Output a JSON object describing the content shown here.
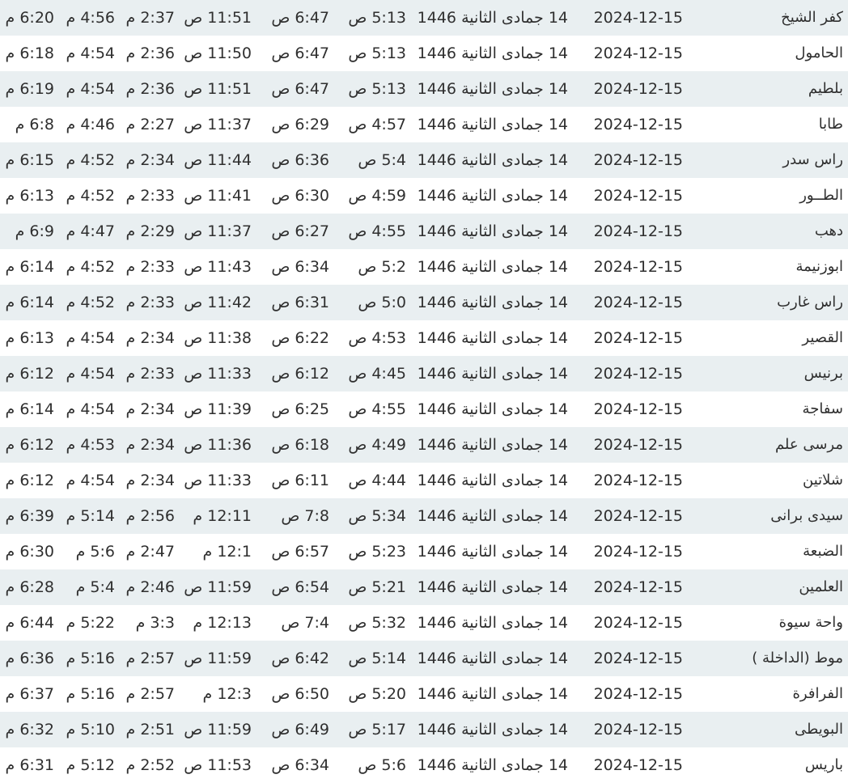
{
  "rows": [
    {
      "city": "كفر الشيخ",
      "gregorian": "2024-12-15",
      "hijri": "14 جمادى الثانية 1446",
      "fajr": "5:13 ص",
      "shuruq": "6:47 ص",
      "dhuhr": "11:51 ص",
      "asr": "2:37 م",
      "maghrib": "4:56 م",
      "isha": "6:20 م"
    },
    {
      "city": "الحامول",
      "gregorian": "2024-12-15",
      "hijri": "14 جمادى الثانية 1446",
      "fajr": "5:13 ص",
      "shuruq": "6:47 ص",
      "dhuhr": "11:50 ص",
      "asr": "2:36 م",
      "maghrib": "4:54 م",
      "isha": "6:18 م"
    },
    {
      "city": "بلطيم",
      "gregorian": "2024-12-15",
      "hijri": "14 جمادى الثانية 1446",
      "fajr": "5:13 ص",
      "shuruq": "6:47 ص",
      "dhuhr": "11:51 ص",
      "asr": "2:36 م",
      "maghrib": "4:54 م",
      "isha": "6:19 م"
    },
    {
      "city": "طابا",
      "gregorian": "2024-12-15",
      "hijri": "14 جمادى الثانية 1446",
      "fajr": "4:57 ص",
      "shuruq": "6:29 ص",
      "dhuhr": "11:37 ص",
      "asr": "2:27 م",
      "maghrib": "4:46 م",
      "isha": "6:8 م"
    },
    {
      "city": "راس سدر",
      "gregorian": "2024-12-15",
      "hijri": "14 جمادى الثانية 1446",
      "fajr": "5:4 ص",
      "shuruq": "6:36 ص",
      "dhuhr": "11:44 ص",
      "asr": "2:34 م",
      "maghrib": "4:52 م",
      "isha": "6:15 م"
    },
    {
      "city": "الطــور",
      "gregorian": "2024-12-15",
      "hijri": "14 جمادى الثانية 1446",
      "fajr": "4:59 ص",
      "shuruq": "6:30 ص",
      "dhuhr": "11:41 ص",
      "asr": "2:33 م",
      "maghrib": "4:52 م",
      "isha": "6:13 م"
    },
    {
      "city": "دهب",
      "gregorian": "2024-12-15",
      "hijri": "14 جمادى الثانية 1446",
      "fajr": "4:55 ص",
      "shuruq": "6:27 ص",
      "dhuhr": "11:37 ص",
      "asr": "2:29 م",
      "maghrib": "4:47 م",
      "isha": "6:9 م"
    },
    {
      "city": "ابوزنيمة",
      "gregorian": "2024-12-15",
      "hijri": "14 جمادى الثانية 1446",
      "fajr": "5:2 ص",
      "shuruq": "6:34 ص",
      "dhuhr": "11:43 ص",
      "asr": "2:33 م",
      "maghrib": "4:52 م",
      "isha": "6:14 م"
    },
    {
      "city": "راس غارب",
      "gregorian": "2024-12-15",
      "hijri": "14 جمادى الثانية 1446",
      "fajr": "5:0 ص",
      "shuruq": "6:31 ص",
      "dhuhr": "11:42 ص",
      "asr": "2:33 م",
      "maghrib": "4:52 م",
      "isha": "6:14 م"
    },
    {
      "city": "القصير",
      "gregorian": "2024-12-15",
      "hijri": "14 جمادى الثانية 1446",
      "fajr": "4:53 ص",
      "shuruq": "6:22 ص",
      "dhuhr": "11:38 ص",
      "asr": "2:34 م",
      "maghrib": "4:54 م",
      "isha": "6:13 م"
    },
    {
      "city": "برنيس",
      "gregorian": "2024-12-15",
      "hijri": "14 جمادى الثانية 1446",
      "fajr": "4:45 ص",
      "shuruq": "6:12 ص",
      "dhuhr": "11:33 ص",
      "asr": "2:33 م",
      "maghrib": "4:54 م",
      "isha": "6:12 م"
    },
    {
      "city": "سفاجة",
      "gregorian": "2024-12-15",
      "hijri": "14 جمادى الثانية 1446",
      "fajr": "4:55 ص",
      "shuruq": "6:25 ص",
      "dhuhr": "11:39 ص",
      "asr": "2:34 م",
      "maghrib": "4:54 م",
      "isha": "6:14 م"
    },
    {
      "city": "مرسى علم",
      "gregorian": "2024-12-15",
      "hijri": "14 جمادى الثانية 1446",
      "fajr": "4:49 ص",
      "shuruq": "6:18 ص",
      "dhuhr": "11:36 ص",
      "asr": "2:34 م",
      "maghrib": "4:53 م",
      "isha": "6:12 م"
    },
    {
      "city": "شلاتين",
      "gregorian": "2024-12-15",
      "hijri": "14 جمادى الثانية 1446",
      "fajr": "4:44 ص",
      "shuruq": "6:11 ص",
      "dhuhr": "11:33 ص",
      "asr": "2:34 م",
      "maghrib": "4:54 م",
      "isha": "6:12 م"
    },
    {
      "city": "سيدى برانى",
      "gregorian": "2024-12-15",
      "hijri": "14 جمادى الثانية 1446",
      "fajr": "5:34 ص",
      "shuruq": "7:8 ص",
      "dhuhr": "12:11 م",
      "asr": "2:56 م",
      "maghrib": "5:14 م",
      "isha": "6:39 م"
    },
    {
      "city": "الضبعة",
      "gregorian": "2024-12-15",
      "hijri": "14 جمادى الثانية 1446",
      "fajr": "5:23 ص",
      "shuruq": "6:57 ص",
      "dhuhr": "12:1 م",
      "asr": "2:47 م",
      "maghrib": "5:6 م",
      "isha": "6:30 م"
    },
    {
      "city": "العلمين",
      "gregorian": "2024-12-15",
      "hijri": "14 جمادى الثانية 1446",
      "fajr": "5:21 ص",
      "shuruq": "6:54 ص",
      "dhuhr": "11:59 ص",
      "asr": "2:46 م",
      "maghrib": "5:4 م",
      "isha": "6:28 م"
    },
    {
      "city": "واحة سيوة",
      "gregorian": "2024-12-15",
      "hijri": "14 جمادى الثانية 1446",
      "fajr": "5:32 ص",
      "shuruq": "7:4 ص",
      "dhuhr": "12:13 م",
      "asr": "3:3 م",
      "maghrib": "5:22 م",
      "isha": "6:44 م"
    },
    {
      "city": "موط (الداخلة )",
      "gregorian": "2024-12-15",
      "hijri": "14 جمادى الثانية 1446",
      "fajr": "5:14 ص",
      "shuruq": "6:42 ص",
      "dhuhr": "11:59 ص",
      "asr": "2:57 م",
      "maghrib": "5:16 م",
      "isha": "6:36 م"
    },
    {
      "city": "الفرافرة",
      "gregorian": "2024-12-15",
      "hijri": "14 جمادى الثانية 1446",
      "fajr": "5:20 ص",
      "shuruq": "6:50 ص",
      "dhuhr": "12:3 م",
      "asr": "2:57 م",
      "maghrib": "5:16 م",
      "isha": "6:37 م"
    },
    {
      "city": "البويطى",
      "gregorian": "2024-12-15",
      "hijri": "14 جمادى الثانية 1446",
      "fajr": "5:17 ص",
      "shuruq": "6:49 ص",
      "dhuhr": "11:59 ص",
      "asr": "2:51 م",
      "maghrib": "5:10 م",
      "isha": "6:32 م"
    },
    {
      "city": "باريس",
      "gregorian": "2024-12-15",
      "hijri": "14 جمادى الثانية 1446",
      "fajr": "5:6 ص",
      "shuruq": "6:34 ص",
      "dhuhr": "11:53 ص",
      "asr": "2:52 م",
      "maghrib": "5:12 م",
      "isha": "6:31 م"
    }
  ]
}
